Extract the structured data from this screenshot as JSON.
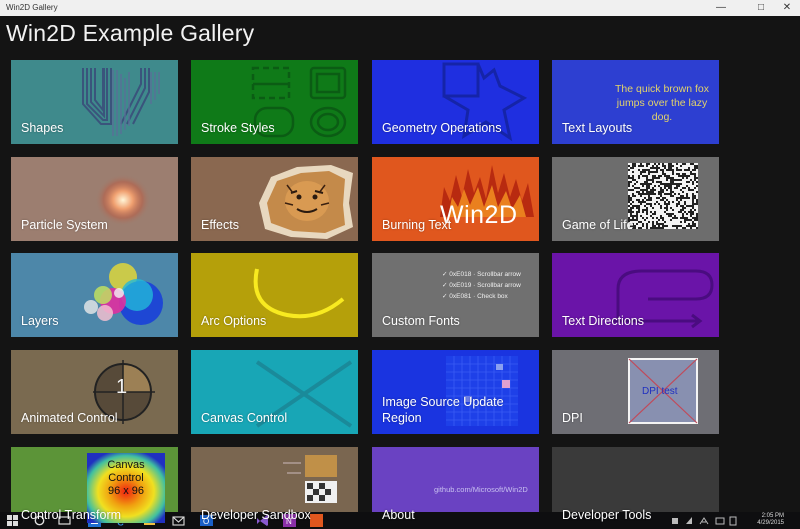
{
  "window": {
    "title": "Win2D Gallery",
    "minimize": "—",
    "maximize": "□",
    "close": "✕"
  },
  "page": {
    "heading": "Win2D Example Gallery"
  },
  "tiles": [
    {
      "label": "Shapes",
      "color": "#3f8a8c"
    },
    {
      "label": "Stroke Styles",
      "color": "#0f7a18"
    },
    {
      "label": "Geometry Operations",
      "color": "#1f2fe0"
    },
    {
      "label": "Text Layouts",
      "color": "#2d3fd1",
      "art_text": "The quick brown fox jumps over the lazy dog."
    },
    {
      "label": "Particle System",
      "color": "#9c7e70"
    },
    {
      "label": "Effects",
      "color": "#8a6850"
    },
    {
      "label": "Burning Text",
      "color": "#e0571e",
      "art_text": "Win2D"
    },
    {
      "label": "Game of Life",
      "color": "#6d6d6d"
    },
    {
      "label": "Layers",
      "color": "#4d87a9"
    },
    {
      "label": "Arc Options",
      "color": "#b5a00a"
    },
    {
      "label": "Custom Fonts",
      "color": "#707070",
      "art_lines": [
        "0xE018 · Scrollbar arrow",
        "0xE019 · Scrollbar arrow",
        "0xE081 · Check box"
      ]
    },
    {
      "label": "Text Directions",
      "color": "#6a14a8"
    },
    {
      "label": "Animated Control",
      "color": "#7a6a50",
      "art_text": "1"
    },
    {
      "label": "Canvas Control",
      "color": "#18a6b6"
    },
    {
      "label": "Image Source Update Region",
      "color": "#1a34e0"
    },
    {
      "label": "DPI",
      "color": "#6e6e74",
      "art_text": "DPI test"
    },
    {
      "label": "Control Transform",
      "color": "#5c9438",
      "art_lines": [
        "Canvas",
        "Control",
        "96 x 96"
      ]
    },
    {
      "label": "Developer Sandbox",
      "color": "#7a6650"
    },
    {
      "label": "About",
      "color": "#6a42c2",
      "art_text": "github.com/Microsoft/Win2D"
    },
    {
      "label": "Developer Tools",
      "color": "#3a3a3a"
    }
  ],
  "taskbar": {
    "time": "2:05 PM",
    "date": "4/29/2015",
    "icons": [
      "start-icon",
      "search-icon",
      "task-view-icon",
      "store-icon",
      "edge-icon",
      "file-explorer-icon",
      "mail-icon",
      "outlook-icon",
      "visual-studio-icon",
      "onenote-icon",
      "win2d-gallery-icon"
    ]
  }
}
